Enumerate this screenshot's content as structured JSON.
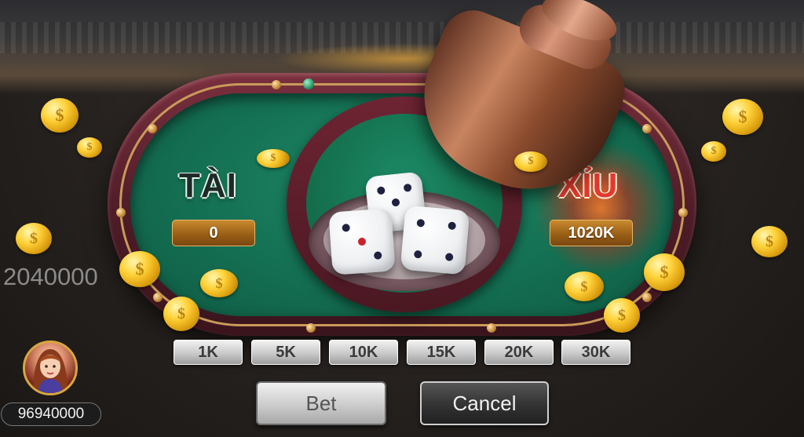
{
  "table": {
    "tai": {
      "title": "TÀI",
      "bet_amount": "0"
    },
    "xiu": {
      "title": "XỈU",
      "bet_amount": "1020K"
    }
  },
  "chips": [
    {
      "label": "1K"
    },
    {
      "label": "5K"
    },
    {
      "label": "10K"
    },
    {
      "label": "15K"
    },
    {
      "label": "20K"
    },
    {
      "label": "30K"
    }
  ],
  "buttons": {
    "bet_label": "Bet",
    "cancel_label": "Cancel"
  },
  "player": {
    "pool_amount": "2040000",
    "balance": "96940000",
    "avatar_icon": "woman-avatar-icon"
  },
  "dice": [
    5,
    3,
    4
  ],
  "colors": {
    "felt": "#157254",
    "rim": "#5e2130",
    "gold": "#d8a640",
    "xiu_red": "#e23a2c"
  }
}
